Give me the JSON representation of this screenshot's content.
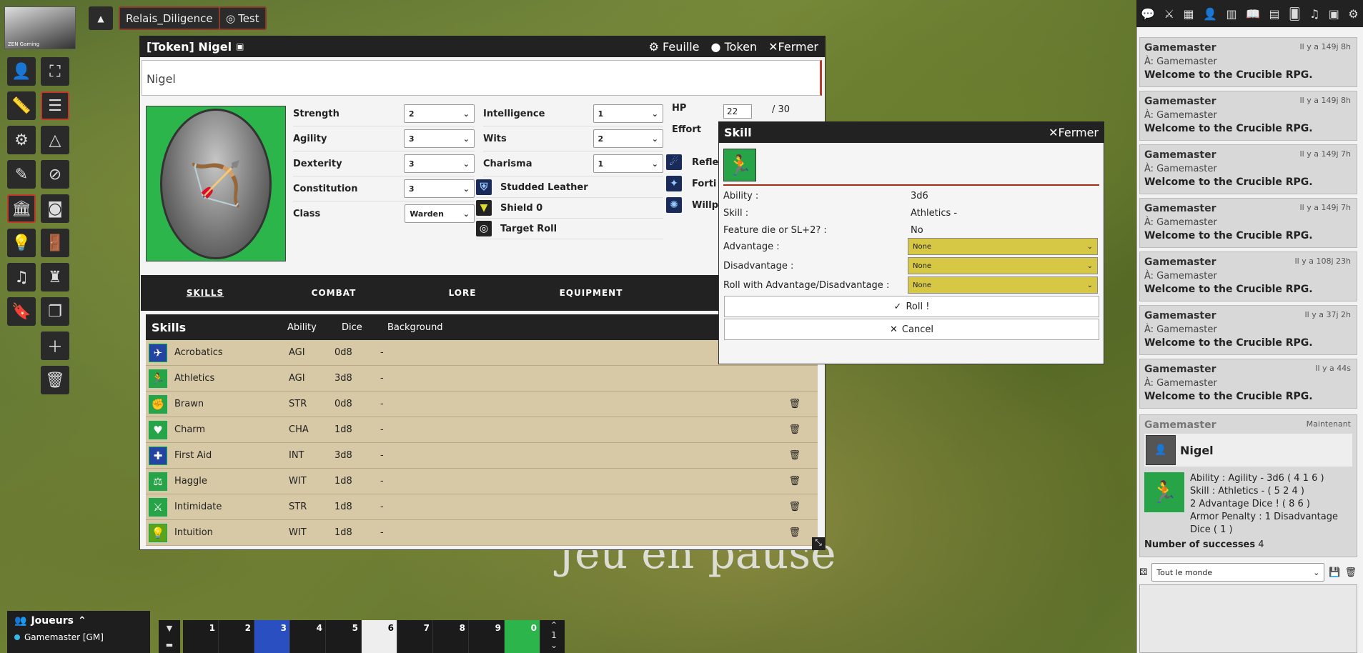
{
  "topbar": {
    "scene_label": "Relais_Diligence",
    "test_label": "Test",
    "logo_text": "ZEN Gaming"
  },
  "sheet": {
    "title": "[Token] Nigel",
    "actions": [
      "Feuille",
      "Token",
      "Fermer"
    ],
    "name": "Nigel",
    "attributes_left": [
      {
        "label": "Strength",
        "value": "2"
      },
      {
        "label": "Agility",
        "value": "3"
      },
      {
        "label": "Dexterity",
        "value": "3"
      },
      {
        "label": "Constitution",
        "value": "3"
      }
    ],
    "class_label": "Class",
    "class_value": "Warden",
    "attributes_mid": [
      {
        "label": "Intelligence",
        "value": "1"
      },
      {
        "label": "Wits",
        "value": "2"
      },
      {
        "label": "Charisma",
        "value": "1"
      }
    ],
    "equipment": [
      "Studded Leather",
      "Shield 0",
      "Target Roll"
    ],
    "hp_label": "HP",
    "hp_value": "22",
    "hp_max": "/ 30",
    "effort_label": "Effort",
    "saves": [
      "Refle",
      "Forti",
      "Willp"
    ],
    "tabs": [
      "SKILLS",
      "COMBAT",
      "LORE",
      "EQUIPMENT"
    ],
    "skills_header": {
      "title": "Skills",
      "ability": "Ability",
      "dice": "Dice",
      "background": "Background"
    },
    "skills": [
      {
        "name": "Acrobatics",
        "ability": "AGI",
        "dice": "0d8",
        "bg": "-"
      },
      {
        "name": "Athletics",
        "ability": "AGI",
        "dice": "3d8",
        "bg": "-"
      },
      {
        "name": "Brawn",
        "ability": "STR",
        "dice": "0d8",
        "bg": "-"
      },
      {
        "name": "Charm",
        "ability": "CHA",
        "dice": "1d8",
        "bg": "-"
      },
      {
        "name": "First Aid",
        "ability": "INT",
        "dice": "3d8",
        "bg": "-"
      },
      {
        "name": "Haggle",
        "ability": "WIT",
        "dice": "1d8",
        "bg": "-"
      },
      {
        "name": "Intimidate",
        "ability": "STR",
        "dice": "1d8",
        "bg": "-"
      },
      {
        "name": "Intuition",
        "ability": "WIT",
        "dice": "1d8",
        "bg": "-"
      }
    ]
  },
  "dialog": {
    "title": "Skill",
    "close": "Fermer",
    "rows": [
      {
        "k": "Ability :",
        "v": "3d6"
      },
      {
        "k": "Skill :",
        "v": "Athletics -"
      },
      {
        "k": "Feature die or SL+2? :",
        "v": "No"
      }
    ],
    "selects": [
      {
        "k": "Advantage :",
        "v": "None"
      },
      {
        "k": "Disadvantage :",
        "v": "None"
      },
      {
        "k": "Roll with Advantage/Disadvantage :",
        "v": "None"
      }
    ],
    "roll": "Roll !",
    "cancel": "Cancel"
  },
  "pause_text": "Jeu en pause",
  "chat": {
    "messages": [
      {
        "who": "Gamemaster",
        "time": "Il y a 149j 8h",
        "to": "À: Gamemaster",
        "body": "Welcome to the Crucible RPG."
      },
      {
        "who": "Gamemaster",
        "time": "Il y a 149j 8h",
        "to": "À: Gamemaster",
        "body": "Welcome to the Crucible RPG."
      },
      {
        "who": "Gamemaster",
        "time": "Il y a 149j 7h",
        "to": "À: Gamemaster",
        "body": "Welcome to the Crucible RPG."
      },
      {
        "who": "Gamemaster",
        "time": "Il y a 149j 7h",
        "to": "À: Gamemaster",
        "body": "Welcome to the Crucible RPG."
      },
      {
        "who": "Gamemaster",
        "time": "Il y a 108j 23h",
        "to": "À: Gamemaster",
        "body": "Welcome to the Crucible RPG."
      },
      {
        "who": "Gamemaster",
        "time": "Il y a 37j 2h",
        "to": "À: Gamemaster",
        "body": "Welcome to the Crucible RPG."
      },
      {
        "who": "Gamemaster",
        "time": "Il y a 44s",
        "to": "À: Gamemaster",
        "body": "Welcome to the Crucible RPG."
      }
    ],
    "roll_msg": {
      "who": "Gamemaster",
      "time": "Maintenant",
      "actor": "Nigel",
      "lines": [
        "Ability : Agility - 3d6 ( 4 1 6 )",
        "Skill : Athletics - ( 5 2 4 )",
        "2 Advantage Dice ! ( 8 6 )",
        "Armor Penalty : 1 Disadvantage Dice ( 1 )"
      ],
      "successes_label": "Number of successes",
      "successes": "4"
    },
    "target_select": "Tout le monde"
  },
  "players": {
    "title": "Joueurs",
    "entry": "Gamemaster [GM]"
  },
  "hotbar": {
    "slots": [
      "1",
      "2",
      "3",
      "4",
      "5",
      "6",
      "7",
      "8",
      "9",
      "0"
    ],
    "page": "1"
  }
}
